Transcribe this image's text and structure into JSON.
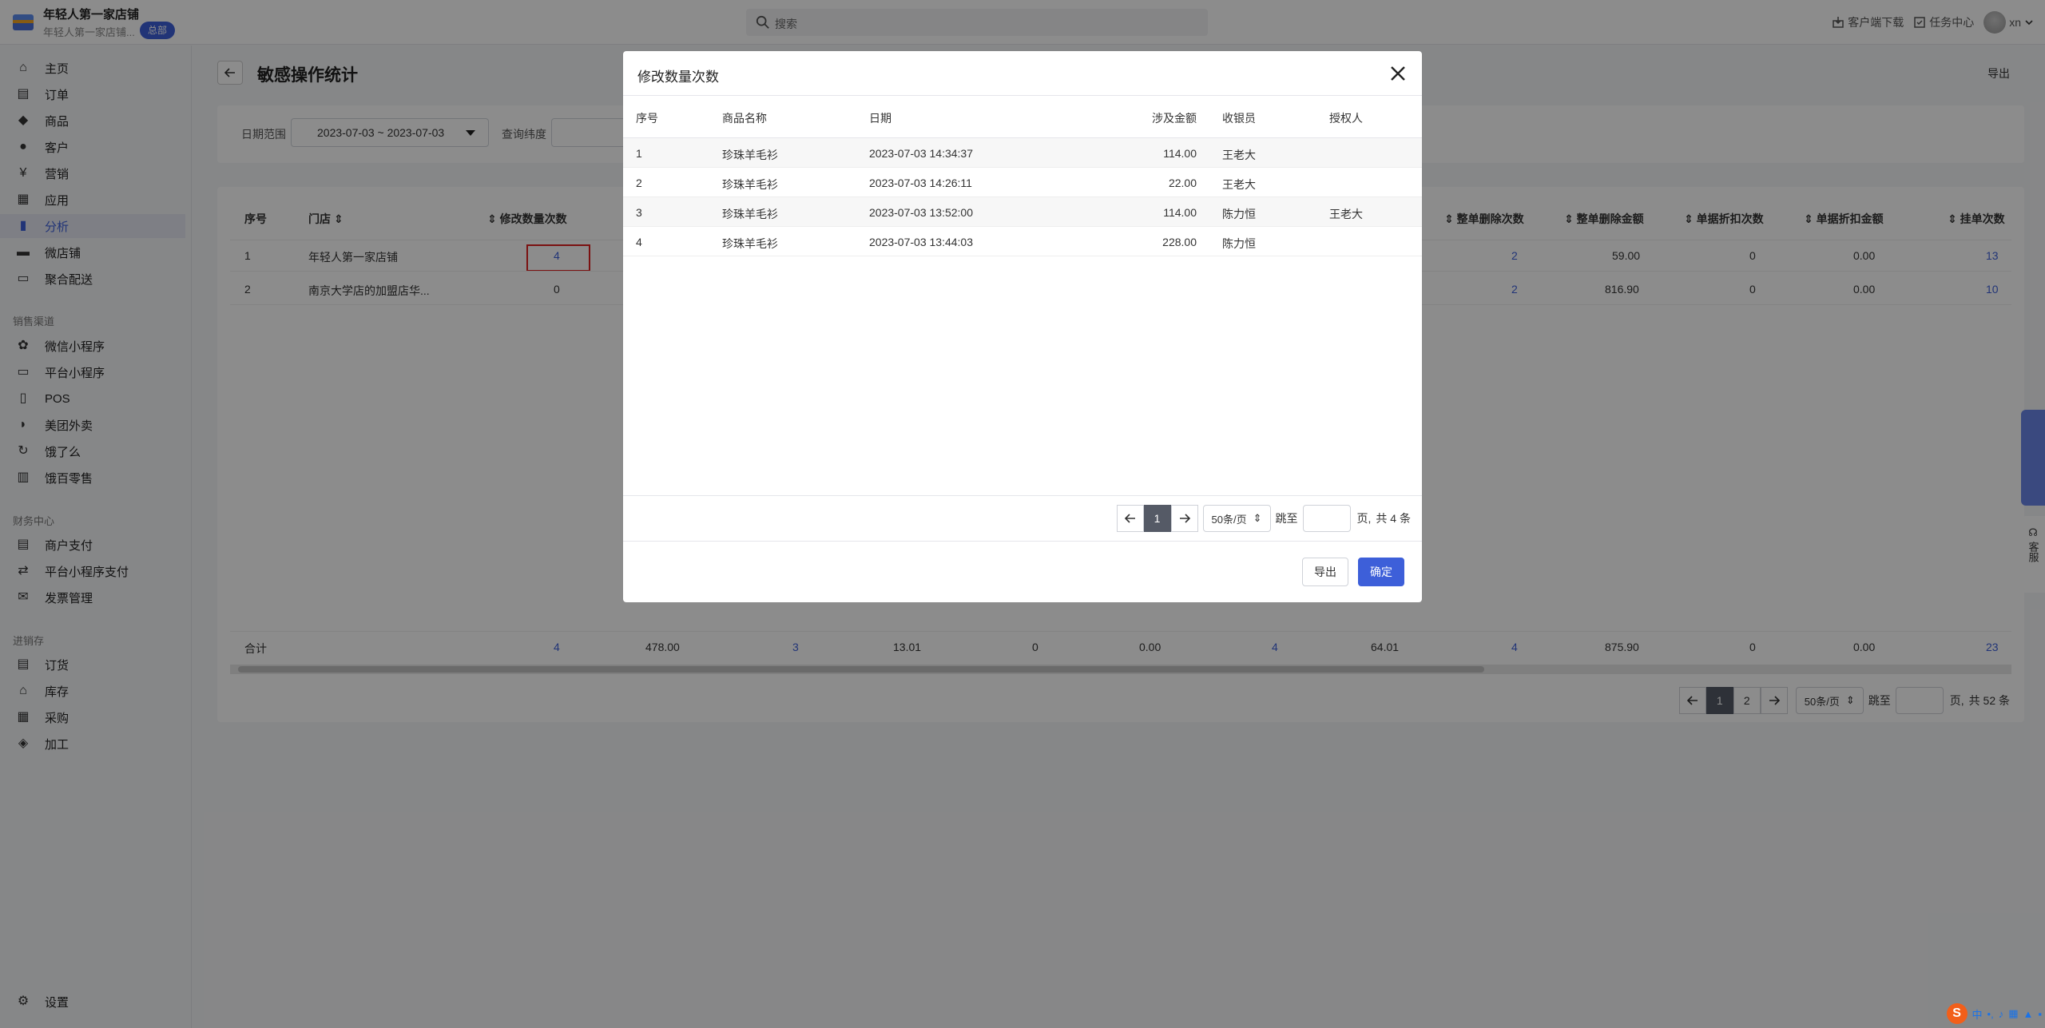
{
  "topbar": {
    "store_name": "年轻人第一家店铺",
    "store_sub": "年轻人第一家店铺...",
    "hq_badge": "总部",
    "search_placeholder": "搜索",
    "client_download": "客户端下载",
    "task_center": "任务中心",
    "user": "xn"
  },
  "sidebar": {
    "items": [
      {
        "label": "主页",
        "icon": "home-icon"
      },
      {
        "label": "订单",
        "icon": "order-icon"
      },
      {
        "label": "商品",
        "icon": "tag-icon"
      },
      {
        "label": "客户",
        "icon": "user-icon"
      },
      {
        "label": "营销",
        "icon": "marketing-icon"
      },
      {
        "label": "应用",
        "icon": "apps-icon"
      },
      {
        "label": "分析",
        "icon": "chart-icon"
      },
      {
        "label": "微店铺",
        "icon": "store-icon"
      },
      {
        "label": "聚合配送",
        "icon": "delivery-icon"
      }
    ],
    "section_sales": "销售渠道",
    "sales_items": [
      {
        "label": "微信小程序",
        "icon": "wechat-mini-icon"
      },
      {
        "label": "平台小程序",
        "icon": "platform-mini-icon"
      },
      {
        "label": "POS",
        "icon": "pos-icon"
      },
      {
        "label": "美团外卖",
        "icon": "meituan-icon"
      },
      {
        "label": "饿了么",
        "icon": "eleme-icon"
      },
      {
        "label": "饿百零售",
        "icon": "basket-icon"
      }
    ],
    "section_finance": "财务中心",
    "finance_items": [
      {
        "label": "商户支付",
        "icon": "merchant-pay-icon"
      },
      {
        "label": "平台小程序支付",
        "icon": "platform-pay-icon"
      },
      {
        "label": "发票管理",
        "icon": "invoice-icon"
      }
    ],
    "section_inventory": "进销存",
    "inventory_items": [
      {
        "label": "订货",
        "icon": "purchase-order-icon"
      },
      {
        "label": "库存",
        "icon": "warehouse-icon"
      },
      {
        "label": "采购",
        "icon": "procurement-icon"
      },
      {
        "label": "加工",
        "icon": "processing-icon"
      }
    ],
    "settings": "设置"
  },
  "page": {
    "title": "敏感操作统计",
    "export": "导出",
    "filter": {
      "date_label": "日期范围",
      "date_value": "2023-07-03 ~ 2023-07-03",
      "dim_label": "查询纬度"
    },
    "table": {
      "headers": [
        "序号",
        "门店",
        "修改数量次数",
        "整单删除次数",
        "整单删除金额",
        "单据折扣次数",
        "单据折扣金额",
        "挂单次数"
      ],
      "rows": [
        {
          "no": "1",
          "store": "年轻人第一家店铺",
          "modify_count": "4",
          "del_count": "2",
          "del_amount": "59.00",
          "disc_count": "0",
          "disc_amount": "0.00",
          "hang_count": "13"
        },
        {
          "no": "2",
          "store": "南京大学店的加盟店华...",
          "modify_count": "0",
          "del_count": "2",
          "del_amount": "816.90",
          "disc_count": "0",
          "disc_amount": "0.00",
          "hang_count": "10"
        }
      ],
      "total": {
        "label": "合计",
        "values": [
          "4",
          "478.00",
          "3",
          "13.01",
          "0",
          "0.00",
          "4",
          "64.01",
          "4",
          "875.90",
          "0",
          "0.00",
          "23"
        ]
      }
    },
    "pager": {
      "pages": [
        "1",
        "2"
      ],
      "size": "50条/页",
      "jump_label": "跳至",
      "page_unit": "页,",
      "total": "共 52 条"
    }
  },
  "modal": {
    "title": "修改数量次数",
    "headers": [
      "序号",
      "商品名称",
      "日期",
      "涉及金额",
      "收银员",
      "授权人"
    ],
    "rows": [
      {
        "no": "1",
        "product": "珍珠羊毛衫",
        "date": "2023-07-03 14:34:37",
        "amount": "114.00",
        "cashier": "王老大",
        "auth": ""
      },
      {
        "no": "2",
        "product": "珍珠羊毛衫",
        "date": "2023-07-03 14:26:11",
        "amount": "22.00",
        "cashier": "王老大",
        "auth": ""
      },
      {
        "no": "3",
        "product": "珍珠羊毛衫",
        "date": "2023-07-03 13:52:00",
        "amount": "114.00",
        "cashier": "陈力恒",
        "auth": "王老大"
      },
      {
        "no": "4",
        "product": "珍珠羊毛衫",
        "date": "2023-07-03 13:44:03",
        "amount": "228.00",
        "cashier": "陈力恒",
        "auth": ""
      }
    ],
    "pager": {
      "page": "1",
      "size": "50条/页",
      "jump_label": "跳至",
      "page_unit": "页,",
      "total": "共 4 条"
    },
    "export_label": "导出",
    "ok_label": "确定"
  },
  "float": {
    "service": "客服"
  },
  "ime": {
    "sogou": "S",
    "lang": "中"
  }
}
